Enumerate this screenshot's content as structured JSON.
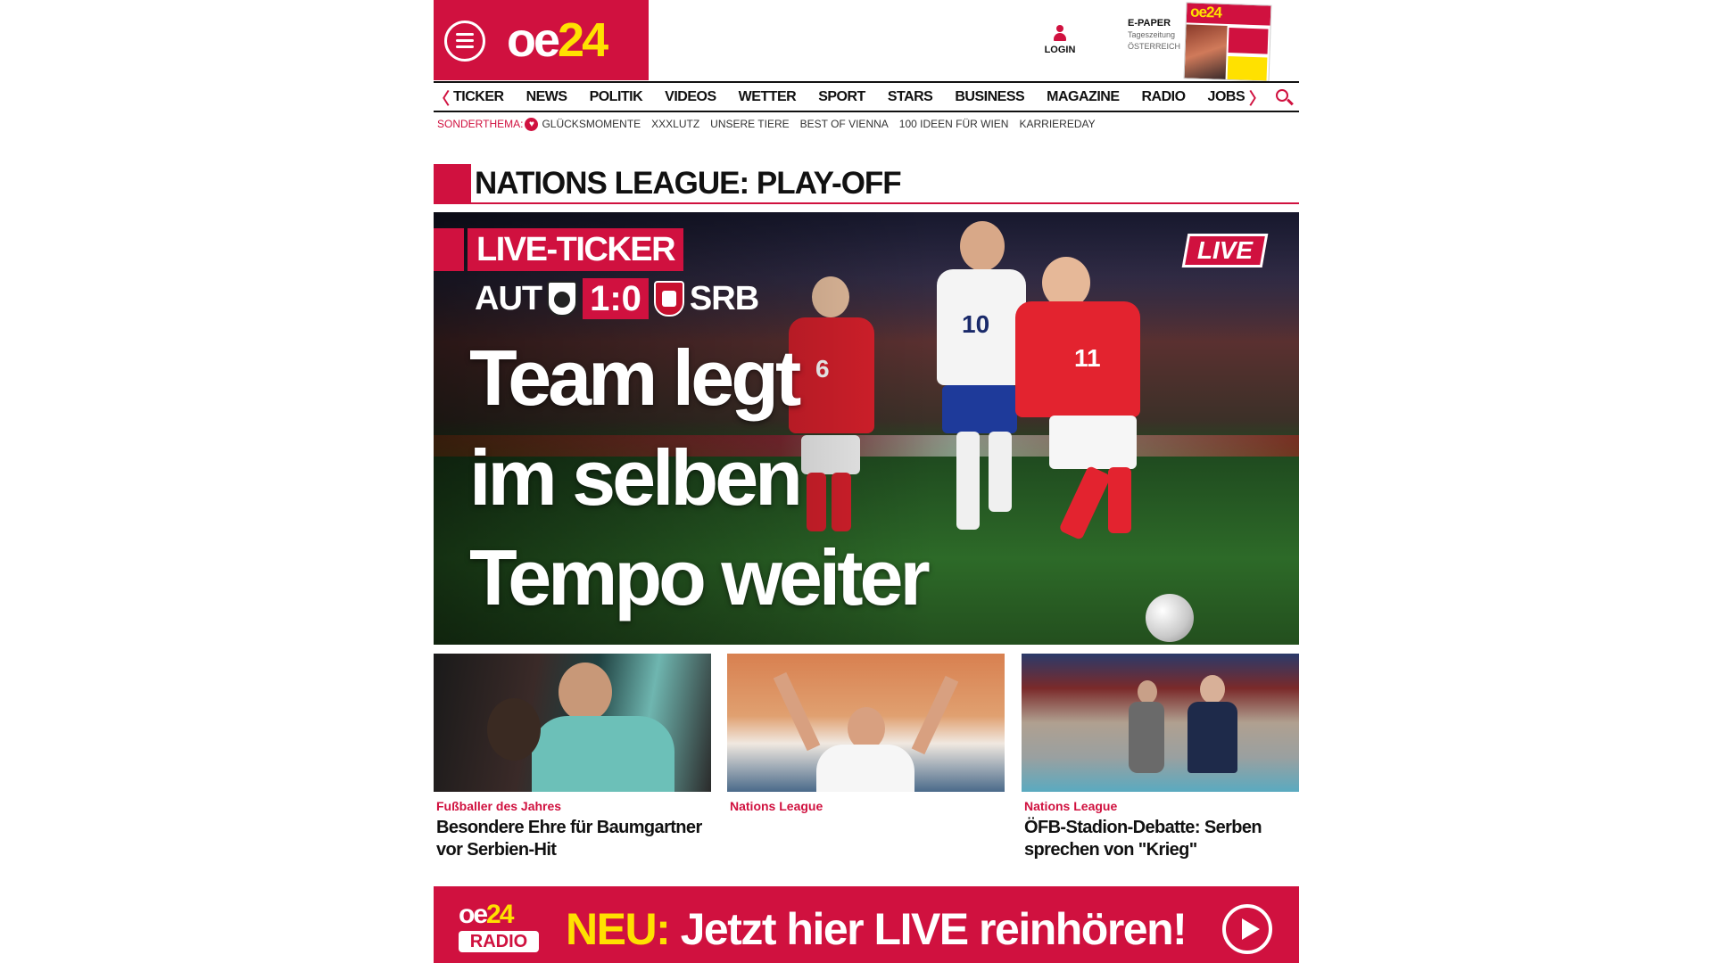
{
  "header": {
    "logo_part1": "oe",
    "logo_part2": "24",
    "login_label": "LOGIN",
    "epaper_title": "E-PAPER",
    "epaper_sub1": "Tageszeitung",
    "epaper_sub2": "ÖSTERREICH",
    "epaper_cover_logo": "oe24"
  },
  "nav": {
    "prev": "〈",
    "next": "〉",
    "items": [
      "TICKER",
      "NEWS",
      "POLITIK",
      "VIDEOS",
      "WETTER",
      "SPORT",
      "STARS",
      "BUSINESS",
      "MAGAZINE",
      "RADIO",
      "JOBS"
    ]
  },
  "subnav": {
    "label": "SONDERTHEMA:",
    "items": [
      "GLÜCKSMOMENTE",
      "XXXLUTZ",
      "UNSERE TIERE",
      "BEST OF VIENNA",
      "100 IDEEN FÜR WIEN",
      "KARRIEREDAY"
    ]
  },
  "section": {
    "title": "NATIONS LEAGUE: PLAY-OFF"
  },
  "hero": {
    "ticker_label": "LIVE-TICKER",
    "live_badge": "LIVE",
    "home_team": "AUT",
    "away_team": "SRB",
    "score": "1:0",
    "headline_lines": [
      "Team legt",
      "im selben",
      "Tempo weiter"
    ],
    "player_numbers": [
      "6",
      "10",
      "11"
    ]
  },
  "teasers": [
    {
      "category": "Fußballer des Jahres",
      "title": "Besondere Ehre für Baumgartner vor Serbien-Hit"
    },
    {
      "category": "Nations League",
      "title": ""
    },
    {
      "category": "Nations League",
      "title": "ÖFB-Stadion-Debatte: Serben sprechen von \"Krieg\""
    }
  ],
  "radio": {
    "logo_top_part1": "oe",
    "logo_top_part2": "24",
    "logo_bottom": "RADIO",
    "neu": "NEU:",
    "cta": "Jetzt hier LIVE reinhören!"
  },
  "colors": {
    "brand_red": "#d0113f",
    "accent_yellow": "#ffe100"
  },
  "icons": [
    "menu-icon",
    "user-icon",
    "chevron-left-icon",
    "chevron-right-icon",
    "search-icon",
    "heart-icon",
    "play-icon"
  ]
}
